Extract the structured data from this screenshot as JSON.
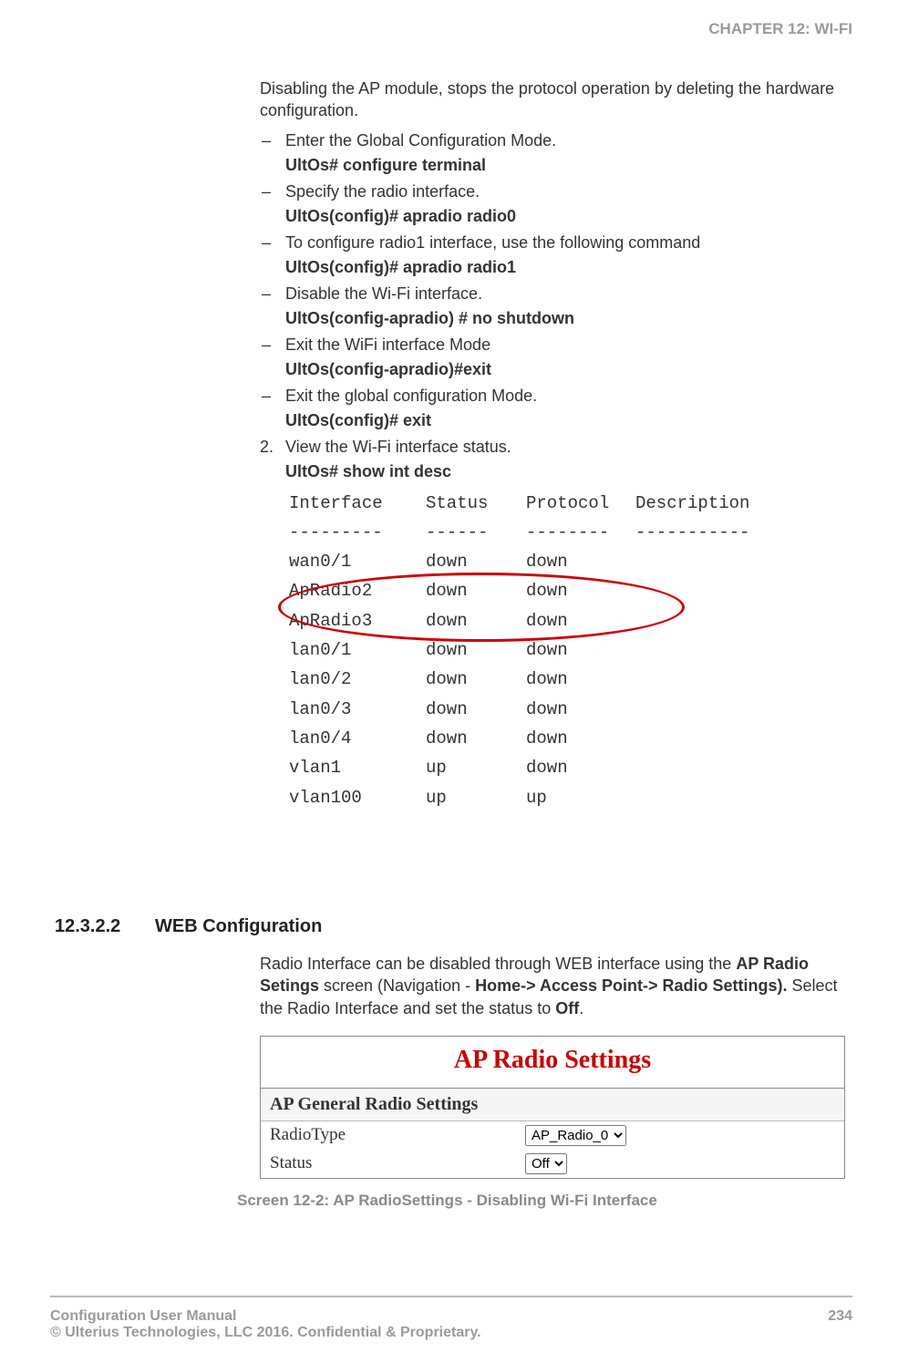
{
  "header": {
    "chapter": "CHAPTER 12: WI-FI"
  },
  "intro": "Disabling the AP module, stops the protocol operation by deleting the hardware configuration.",
  "steps": [
    {
      "text": "Enter the Global Configuration Mode.",
      "cmd": "UltOs# configure terminal"
    },
    {
      "text": "Specify the radio interface.",
      "cmd": "UltOs(config)# apradio radio0"
    },
    {
      "text": "To configure radio1 interface, use the following command",
      "cmd": "UltOs(config)# apradio radio1"
    },
    {
      "text": "Disable the Wi-Fi interface.",
      "cmd": "UltOs(config-apradio) # no shutdown"
    },
    {
      "text": "Exit the WiFi interface Mode",
      "cmd": "UltOs(config-apradio)#exit"
    },
    {
      "text": "Exit the global configuration Mode.",
      "cmd": "UltOs(config)# exit"
    }
  ],
  "step2": {
    "num": "2.",
    "text": "View the Wi-Fi interface status.",
    "cmd": "UltOs# show int desc"
  },
  "table": {
    "headers": {
      "if": "Interface",
      "stat": "Status",
      "prot": "Protocol",
      "desc": "Description"
    },
    "sep": {
      "if": "---------",
      "stat": "------",
      "prot": "--------",
      "desc": "-----------"
    },
    "rows": [
      {
        "if": "wan0/1",
        "stat": "down",
        "prot": "down",
        "desc": ""
      },
      {
        "if": "ApRadio2",
        "stat": "down",
        "prot": "down",
        "desc": ""
      },
      {
        "if": "ApRadio3",
        "stat": "down",
        "prot": "down",
        "desc": ""
      },
      {
        "if": "lan0/1",
        "stat": "down",
        "prot": "down",
        "desc": ""
      },
      {
        "if": "lan0/2",
        "stat": "down",
        "prot": "down",
        "desc": ""
      },
      {
        "if": "lan0/3",
        "stat": "down",
        "prot": "down",
        "desc": ""
      },
      {
        "if": "lan0/4",
        "stat": "down",
        "prot": "down",
        "desc": ""
      },
      {
        "if": "vlan1",
        "stat": "up",
        "prot": "down",
        "desc": ""
      },
      {
        "if": "vlan100",
        "stat": "up",
        "prot": "up",
        "desc": ""
      }
    ]
  },
  "section": {
    "num": "12.3.2.2",
    "title": "WEB Configuration"
  },
  "webtext": {
    "p1a": "Radio Interface can be disabled through WEB interface using the ",
    "p1b": "AP Radio Setings",
    "p1c": " screen (Navigation - ",
    "p1d": "Home-> Access Point-> Radio Settings).",
    "p1e": " Select the Radio Interface and set the status to ",
    "p1f": "Off",
    "p1g": "."
  },
  "settings": {
    "title": "AP Radio Settings",
    "subtitle": "AP General Radio Settings",
    "radiotype_label": "RadioType",
    "radiotype_value": "AP_Radio_0",
    "status_label": "Status",
    "status_value": "Off"
  },
  "caption": "Screen 12-2: AP RadioSettings - Disabling Wi-Fi Interface",
  "footer": {
    "left1": "Configuration User Manual",
    "left2": "© Ulterius Technologies, LLC 2016. Confidential & Proprietary.",
    "page": "234"
  }
}
